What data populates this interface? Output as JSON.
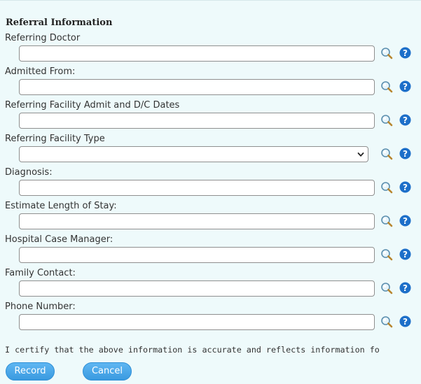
{
  "section": {
    "title": "Referral Information"
  },
  "fields": [
    {
      "label": "Referring Doctor",
      "value": "",
      "type": "text"
    },
    {
      "label": "Admitted From:",
      "value": "",
      "type": "text"
    },
    {
      "label": "Referring Facility Admit and D/C Dates",
      "value": "",
      "type": "text"
    },
    {
      "label": "Referring Facility Type",
      "value": "",
      "type": "select"
    },
    {
      "label": "Diagnosis:",
      "value": "",
      "type": "text"
    },
    {
      "label": "Estimate Length of Stay:",
      "value": "",
      "type": "text"
    },
    {
      "label": "Hospital Case Manager:",
      "value": "",
      "type": "text"
    },
    {
      "label": "Family Contact:",
      "value": "",
      "type": "text"
    },
    {
      "label": "Phone Number:",
      "value": "",
      "type": "text"
    }
  ],
  "certify_text": "I certify that the above information is accurate and reflects information fo",
  "buttons": {
    "record_label": "Record",
    "cancel_label": "Cancel"
  },
  "icons": {
    "lookup": "magnifier-lookup-icon",
    "help": "question-help-icon"
  },
  "colors": {
    "background": "#eefafb",
    "button": "#3a9ae0",
    "help_icon": "#1d6fc9"
  }
}
